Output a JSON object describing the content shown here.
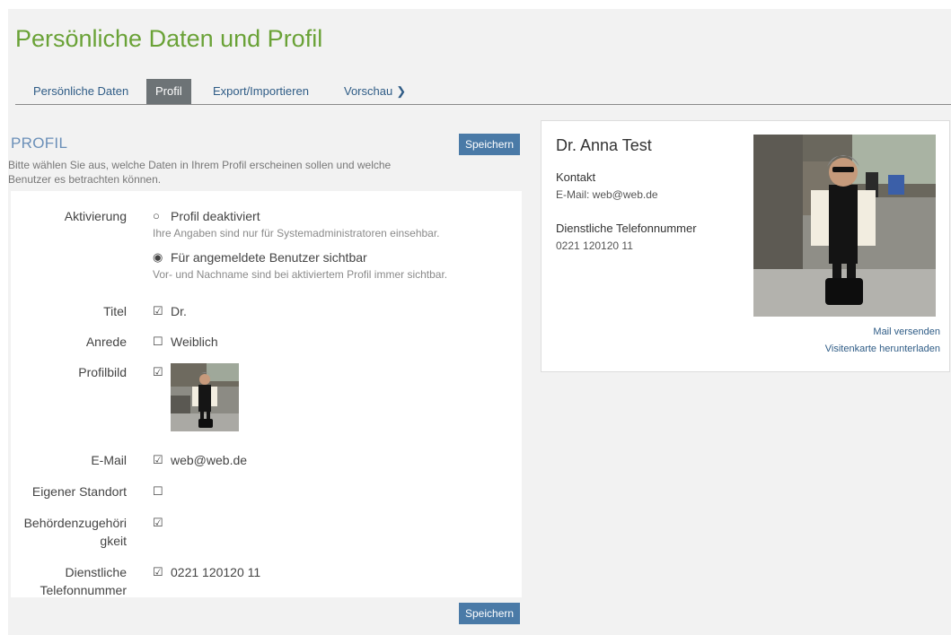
{
  "page": {
    "title": "Persönliche Daten und Profil"
  },
  "tabs": [
    {
      "label": "Persönliche Daten"
    },
    {
      "label": "Profil"
    },
    {
      "label": "Export/Importieren"
    },
    {
      "label": "Vorschau"
    }
  ],
  "profil": {
    "heading": "PROFIL",
    "description": "Bitte wählen Sie aus, welche Daten in Ihrem Profil erscheinen sollen und welche Benutzer es betrachten können.",
    "save_label": "Speichern",
    "activation": {
      "label": "Aktivierung",
      "options": [
        {
          "label": "Profil deaktiviert",
          "hint": "Ihre Angaben sind nur für Systemadministratoren einsehbar.",
          "selected": false
        },
        {
          "label": "Für angemeldete Benutzer sichtbar",
          "hint": "Vor- und Nachname sind bei aktiviertem Profil immer sichtbar.",
          "selected": true
        }
      ]
    },
    "fields": [
      {
        "label": "Titel",
        "checked": true,
        "value": "Dr."
      },
      {
        "label": "Anrede",
        "checked": false,
        "value": "Weiblich"
      },
      {
        "label": "Profilbild",
        "checked": true,
        "value": ""
      },
      {
        "label": "E-Mail",
        "checked": true,
        "value": "web@web.de"
      },
      {
        "label": "Eigener Standort",
        "checked": false,
        "value": ""
      },
      {
        "label": "Behördenzugehörigkeit",
        "checked": true,
        "value": ""
      },
      {
        "label": "Dienstliche Telefonnummer",
        "checked": true,
        "value": "0221 120120 11"
      }
    ],
    "checkbox_glyphs": {
      "checked": "☑",
      "unchecked": "☐"
    }
  },
  "card": {
    "name": "Dr. Anna Test",
    "contact_heading": "Kontakt",
    "email_line": "E-Mail: web@web.de",
    "phone_heading": "Dienstliche Telefonnummer",
    "phone": "0221 120120 11",
    "mail_link": "Mail versenden",
    "vcard_link": "Visitenkarte herunterladen"
  },
  "colors": {
    "title": "#6aa237",
    "accent": "#4a7aa7",
    "link": "#2f5c86",
    "active_tab": "#6d7376",
    "panel": "#f2f2f2"
  }
}
